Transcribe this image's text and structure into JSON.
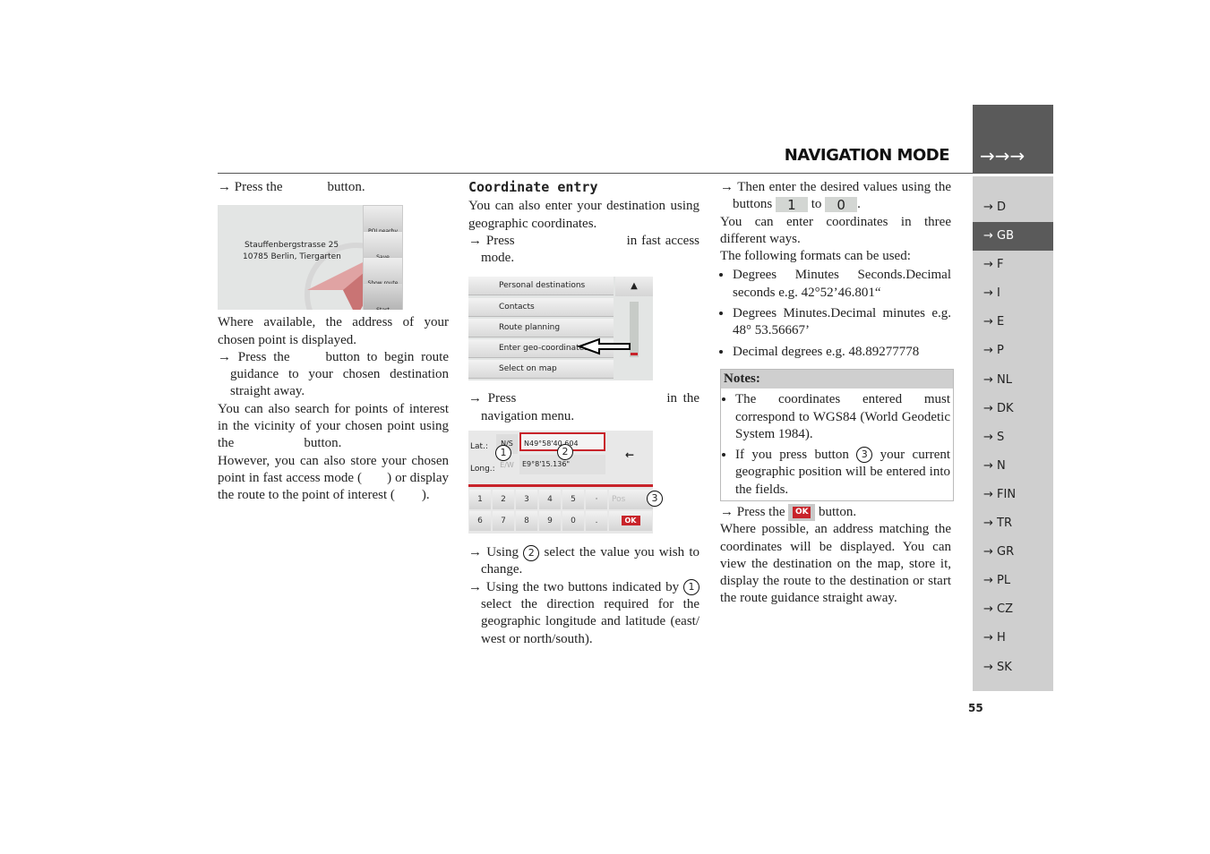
{
  "header": {
    "title": "NAVIGATION MODE",
    "arrows": "→→→"
  },
  "sidebar": {
    "items": [
      "→ D",
      "→ GB",
      "→ F",
      "→ I",
      "→ E",
      "→ P",
      "→ NL",
      "→ DK",
      "→ S",
      "→ N",
      "→ FIN",
      "→ TR",
      "→ GR",
      "→ PL",
      "→ CZ",
      "→ H",
      "→ SK"
    ],
    "active": "→ GB"
  },
  "page_number": "55",
  "left": {
    "p1a": "→ Press the",
    "p1b": "button.",
    "shot": {
      "address1": "Stauffenbergstrasse 25",
      "address2": "10785 Berlin, Tiergarten",
      "buttons": [
        "POI nearby",
        "Save",
        "Show route",
        "Start"
      ]
    },
    "p2": "Where available, the address of your chosen point is displayed.",
    "p3a": "→ Press the",
    "p3b": "button to begin route guidance to your chosen destination straight away.",
    "p4a": "You can also search for points of interest in the vicinity of your chosen point using the",
    "p4b": "button.",
    "p5a": "However, you can also store your chosen point in fast access mode (",
    "p5b": ") or display the route to the point of interest (",
    "p5c": ")."
  },
  "middle": {
    "heading": "Coordinate entry",
    "p1": "You can also enter your destination using geographic coordinates.",
    "p2a": "→ Press",
    "p2b": "in fast access mode.",
    "menu": [
      "Personal destinations",
      "Contacts",
      "Route planning",
      "Enter geo-coordinates",
      "Select on map"
    ],
    "scroll_up": "▲",
    "p3a": "→ Press",
    "p3b": "in the navigation menu.",
    "coord": {
      "lat_label": "Lat.:",
      "long_label": "Long.:",
      "ns": "N/S",
      "ew": "E/W",
      "lat_value": "N49°58'40.604",
      "long_value": "E9°8'15.136\"",
      "backspace": "←",
      "keys_row1": [
        "1",
        "2",
        "3",
        "4",
        "5",
        "·",
        "Pos"
      ],
      "keys_row2": [
        "6",
        "7",
        "8",
        "9",
        "0",
        "."
      ],
      "ok": "OK"
    },
    "callouts": [
      "1",
      "2",
      "3"
    ],
    "p4a": "→ Using",
    "p4b": "select the value you wish to change.",
    "p5a": "→ Using the two buttons indicated by",
    "p5b": "select the direction required for the geographic longitude and latitude (east/ west or north/south)."
  },
  "right": {
    "p1a": "→ Then enter the desired values using the buttons",
    "key1": "1",
    "to": "to",
    "key0": "0",
    "p2": "You can enter coordinates in three different ways.",
    "p3": "The following formats can be used:",
    "formats": [
      "Degrees Minutes Seconds.Decimal seconds e.g. 42°52’46.801“",
      "Degrees Minutes.Decimal minutes e.g. 48° 53.56667’",
      "Decimal degrees e.g. 48.89277778"
    ],
    "notes_title": "Notes:",
    "note1": "The coordinates entered must correspond to WGS84 (World Geodetic System 1984).",
    "note2a": "If you press button",
    "note2b": "your current geographic position will be entered into the fields.",
    "p4a": "→ Press the",
    "ok": "OK",
    "p4b": "button.",
    "p5": "Where possible, an address matching the coordinates will be displayed. You can view the destination on the map, store it, display the route to the destination or start the route guidance straight away."
  },
  "colors": {
    "sidebar_bg": "#cfcfcf",
    "sidebar_active": "#5a5a5a",
    "accent_red": "#c8232a"
  }
}
